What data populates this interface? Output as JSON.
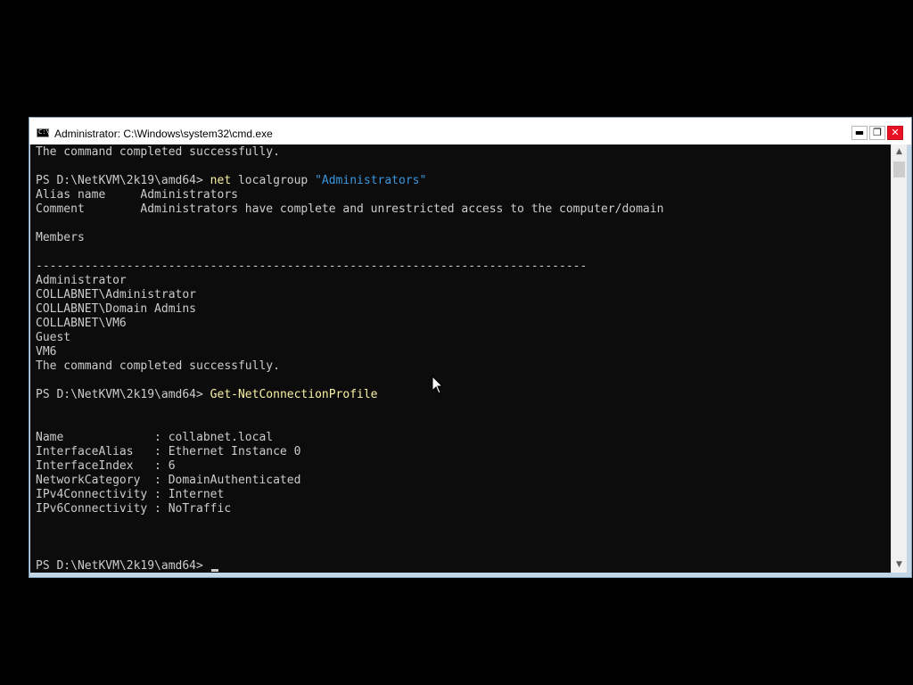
{
  "window": {
    "title": "Administrator: C:\\Windows\\system32\\cmd.exe",
    "icon": "cmd-console-icon",
    "icon_glyph": "C:\\",
    "buttons": {
      "minimize": "▬",
      "maximize": "❐",
      "close": "✕"
    }
  },
  "console": {
    "lines": [
      [
        {
          "t": "The command completed successfully."
        }
      ],
      [],
      [
        {
          "t": "PS D:\\NetKVM\\2k19\\amd64> "
        },
        {
          "t": "net",
          "c": "cmd"
        },
        {
          "t": " localgroup "
        },
        {
          "t": "\"Administrators\"",
          "c": "str"
        }
      ],
      [
        {
          "t": "Alias name     Administrators"
        }
      ],
      [
        {
          "t": "Comment        Administrators have complete and unrestricted access to the computer/domain"
        }
      ],
      [],
      [
        {
          "t": "Members"
        }
      ],
      [],
      [
        {
          "t": "-------------------------------------------------------------------------------"
        }
      ],
      [
        {
          "t": "Administrator"
        }
      ],
      [
        {
          "t": "COLLABNET\\Administrator"
        }
      ],
      [
        {
          "t": "COLLABNET\\Domain Admins"
        }
      ],
      [
        {
          "t": "COLLABNET\\VM6"
        }
      ],
      [
        {
          "t": "Guest"
        }
      ],
      [
        {
          "t": "VM6"
        }
      ],
      [
        {
          "t": "The command completed successfully."
        }
      ],
      [],
      [
        {
          "t": "PS D:\\NetKVM\\2k19\\amd64> "
        },
        {
          "t": "Get-NetConnectionProfile",
          "c": "cmd"
        }
      ],
      [],
      [],
      [
        {
          "t": "Name             : collabnet.local"
        }
      ],
      [
        {
          "t": "InterfaceAlias   : Ethernet Instance 0"
        }
      ],
      [
        {
          "t": "InterfaceIndex   : 6"
        }
      ],
      [
        {
          "t": "NetworkCategory  : DomainAuthenticated"
        }
      ],
      [
        {
          "t": "IPv4Connectivity : Internet"
        }
      ],
      [
        {
          "t": "IPv6Connectivity : NoTraffic"
        }
      ],
      [],
      [],
      [],
      [
        {
          "t": "PS D:\\NetKVM\\2k19\\amd64> "
        },
        {
          "cursor": true
        }
      ]
    ]
  },
  "colors": {
    "console_bg": "#0c0c0c",
    "text": "#cccccc",
    "command": "#f9f1a5",
    "string": "#3a96dd"
  }
}
